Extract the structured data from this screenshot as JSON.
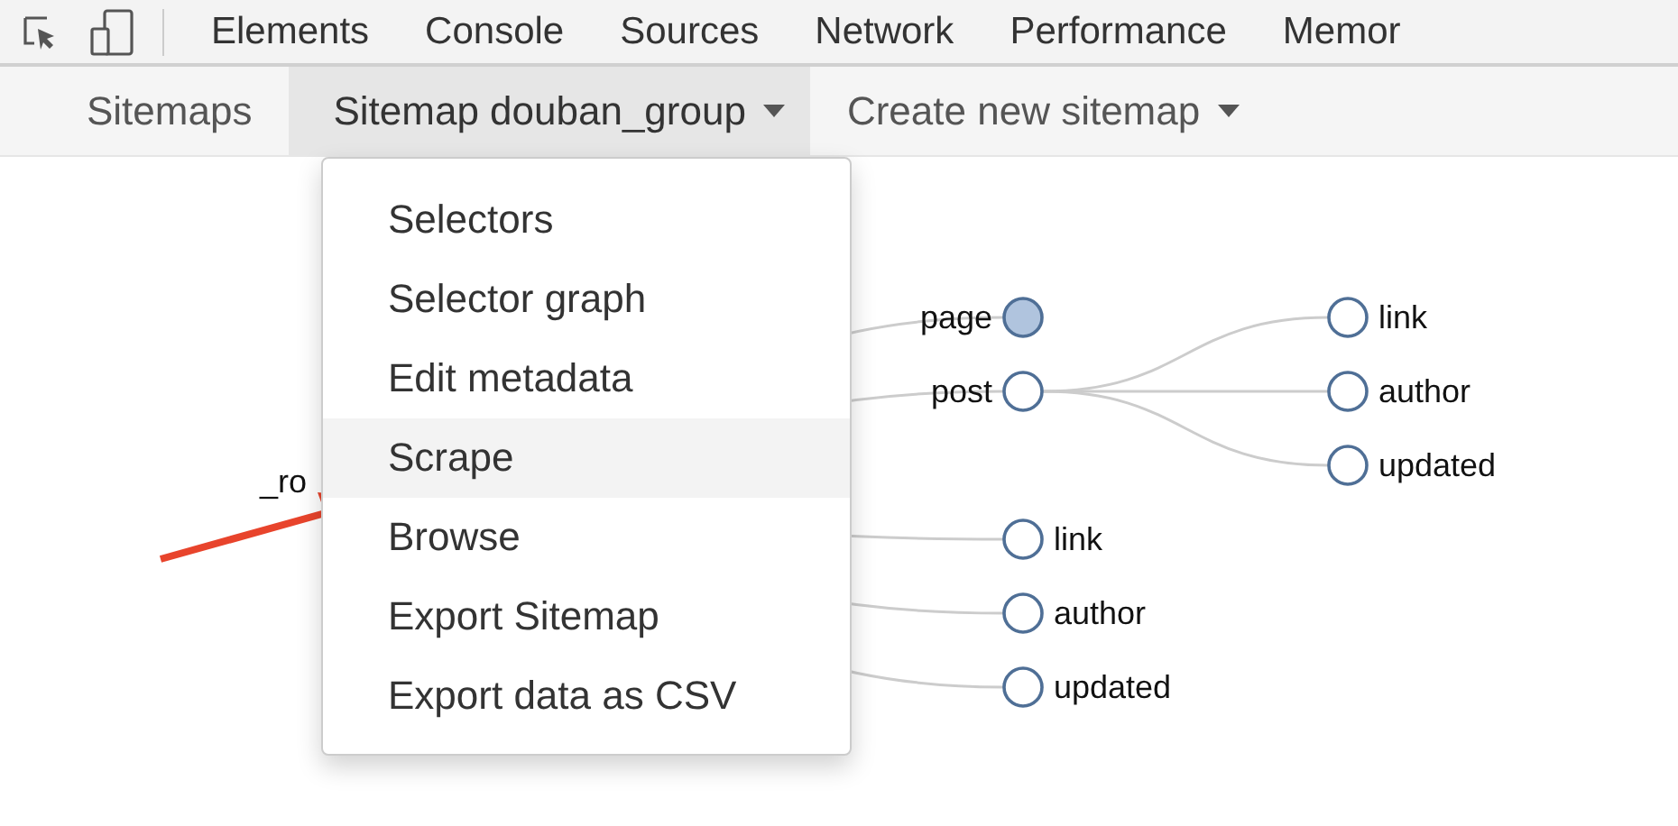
{
  "devtools_tabs": [
    "Elements",
    "Console",
    "Sources",
    "Network",
    "Performance",
    "Memor"
  ],
  "tabs": [
    {
      "label": "Sitemaps",
      "selected": false,
      "dropdown": false
    },
    {
      "label": "Sitemap douban_group",
      "selected": true,
      "dropdown": true
    },
    {
      "label": "Create new sitemap",
      "selected": false,
      "dropdown": true
    }
  ],
  "menu": [
    {
      "label": "Selectors",
      "selected": false
    },
    {
      "label": "Selector graph",
      "selected": false
    },
    {
      "label": "Edit metadata",
      "selected": false
    },
    {
      "label": "Scrape",
      "selected": true
    },
    {
      "label": "Browse",
      "selected": false
    },
    {
      "label": "Export Sitemap",
      "selected": false
    },
    {
      "label": "Export data as CSV",
      "selected": false
    }
  ],
  "graph": {
    "label": "_ro",
    "children": [
      {
        "label": "page",
        "collapsed": true
      },
      {
        "label": "post",
        "collapsed": false,
        "children": [
          {
            "label": "link",
            "collapsed": false
          },
          {
            "label": "author",
            "collapsed": false
          },
          {
            "label": "updated",
            "collapsed": false
          }
        ]
      },
      {
        "label": "link",
        "collapsed": false
      },
      {
        "label": "author",
        "collapsed": false
      },
      {
        "label": "updated",
        "collapsed": false
      }
    ]
  }
}
